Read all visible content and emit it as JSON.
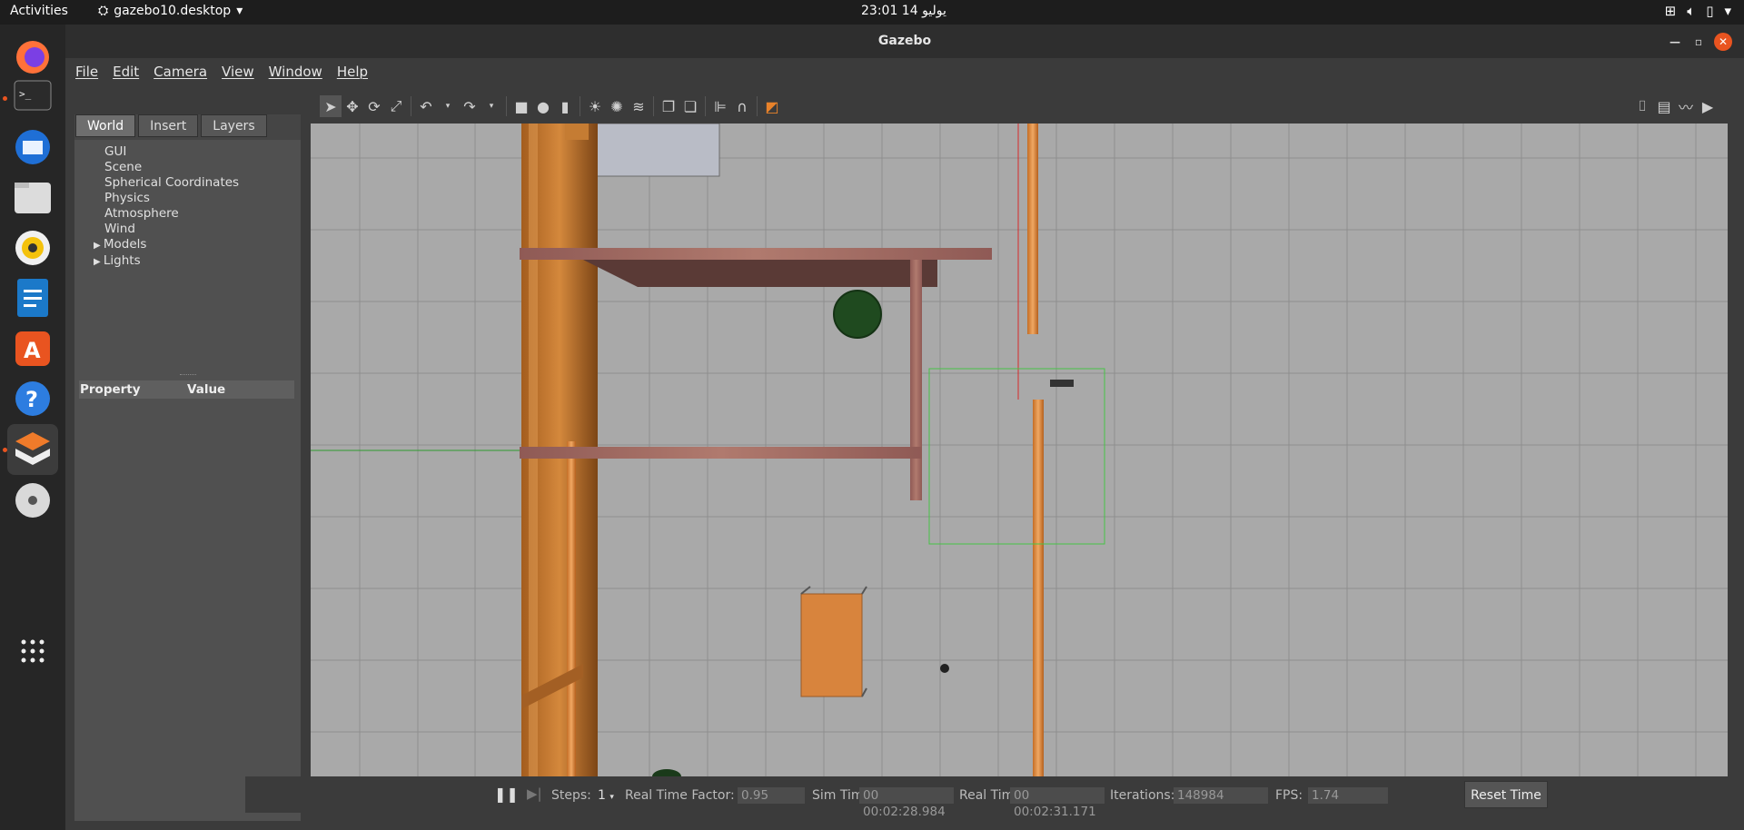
{
  "topbar": {
    "activities": "Activities",
    "app_name": "gazebo10.desktop",
    "clock": "23:01  14 يوليو"
  },
  "dock": {
    "items": [
      "firefox-icon",
      "terminal-icon",
      "thunderbird-icon",
      "files-icon",
      "rhythmbox-icon",
      "writer-icon",
      "software-icon",
      "help-icon",
      "gazebo-icon",
      "dvd-icon",
      "apps-grid-icon"
    ]
  },
  "window": {
    "title": "Gazebo"
  },
  "menu": {
    "file": "File",
    "edit": "Edit",
    "camera": "Camera",
    "view": "View",
    "window": "Window",
    "help": "Help"
  },
  "tabs": {
    "world": "World",
    "insert": "Insert",
    "layers": "Layers"
  },
  "tree": {
    "items": [
      "GUI",
      "Scene",
      "Spherical Coordinates",
      "Physics",
      "Atmosphere",
      "Wind",
      "Models",
      "Lights"
    ]
  },
  "props": {
    "property": "Property",
    "value": "Value"
  },
  "bottom": {
    "steps_label": "Steps:",
    "steps_value": "1",
    "rtf_label": "Real Time Factor:",
    "rtf_value": "0.95",
    "simtime_label": "Sim Time:",
    "simtime_value": "00 00:02:28.984",
    "realtime_label": "Real Time:",
    "realtime_value": "00 00:02:31.171",
    "iter_label": "Iterations:",
    "iter_value": "148984",
    "fps_label": "FPS:",
    "fps_value": "1.74",
    "reset": "Reset Time"
  },
  "colors": {
    "accent": "#e95420",
    "grid_bg": "#a8a8a8",
    "wood": "#c97a32"
  }
}
